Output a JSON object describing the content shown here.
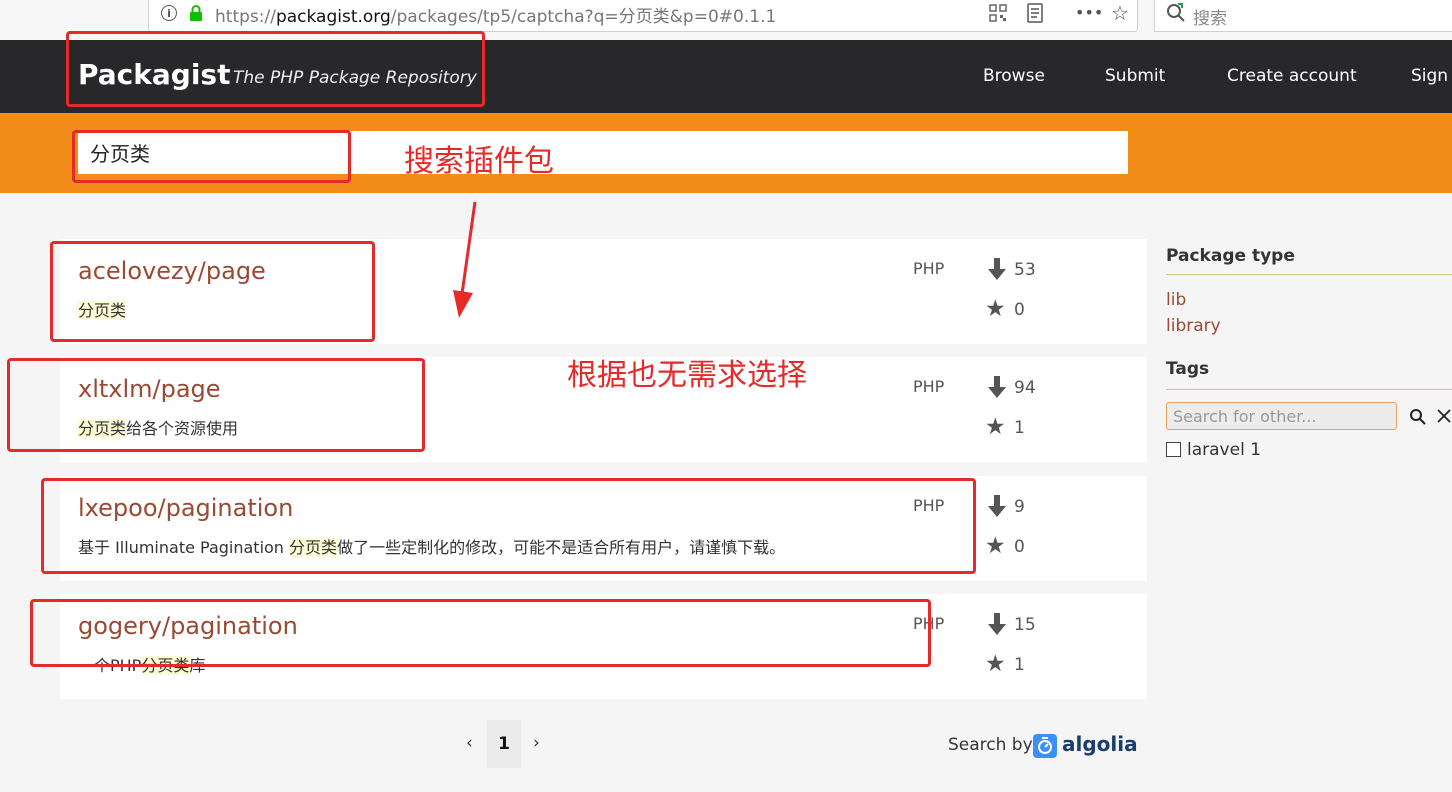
{
  "browser": {
    "url_prefix": "https://",
    "url_domain": "packagist.org",
    "url_rest": "/packages/tp5/captcha?q=分页类&p=0#0.1.1",
    "search_placeholder": "搜索"
  },
  "header": {
    "logo": "Packagist",
    "tagline": "The PHP Package Repository",
    "nav": [
      "Browse",
      "Submit",
      "Create account",
      "Sign"
    ]
  },
  "search": {
    "value": "分页类"
  },
  "results": [
    {
      "name": "acelovezy/page",
      "desc_pre": "",
      "desc_hl": "分页类",
      "desc_post": "",
      "lang": "PHP",
      "downloads": "53",
      "stars": "0"
    },
    {
      "name": "xltxlm/page",
      "desc_pre": "",
      "desc_hl": "分页类",
      "desc_post": "给各个资源使用",
      "lang": "PHP",
      "downloads": "94",
      "stars": "1"
    },
    {
      "name": "lxepoo/pagination",
      "desc_pre": "基于 Illuminate Pagination ",
      "desc_hl": "分页类",
      "desc_post": "做了一些定制化的修改，可能不是适合所有用户，请谨慎下载。",
      "lang": "PHP",
      "downloads": "9",
      "stars": "0"
    },
    {
      "name": "gogery/pagination",
      "desc_pre": "一个PHP",
      "desc_hl": "分页类",
      "desc_post": "库",
      "lang": "PHP",
      "downloads": "15",
      "stars": "1"
    }
  ],
  "sidebar": {
    "package_type_heading": "Package type",
    "package_types": [
      "lib",
      "library"
    ],
    "tags_heading": "Tags",
    "tag_search_placeholder": "Search for other...",
    "tag_option": "laravel 1"
  },
  "pagination": {
    "prev": "‹",
    "current": "1",
    "next": "›"
  },
  "footer": {
    "search_by": "Search by",
    "brand": "algolia"
  },
  "annotations": {
    "search_note": "搜索插件包",
    "choose_note": "根据也无需求选择"
  },
  "colors": {
    "header_bg": "#28282b",
    "search_band": "#f28d1a",
    "link": "#9a4a34",
    "highlight": "#fdfbd5",
    "annotation_red": "#e62a2a",
    "algolia_blue": "#5468ff"
  }
}
